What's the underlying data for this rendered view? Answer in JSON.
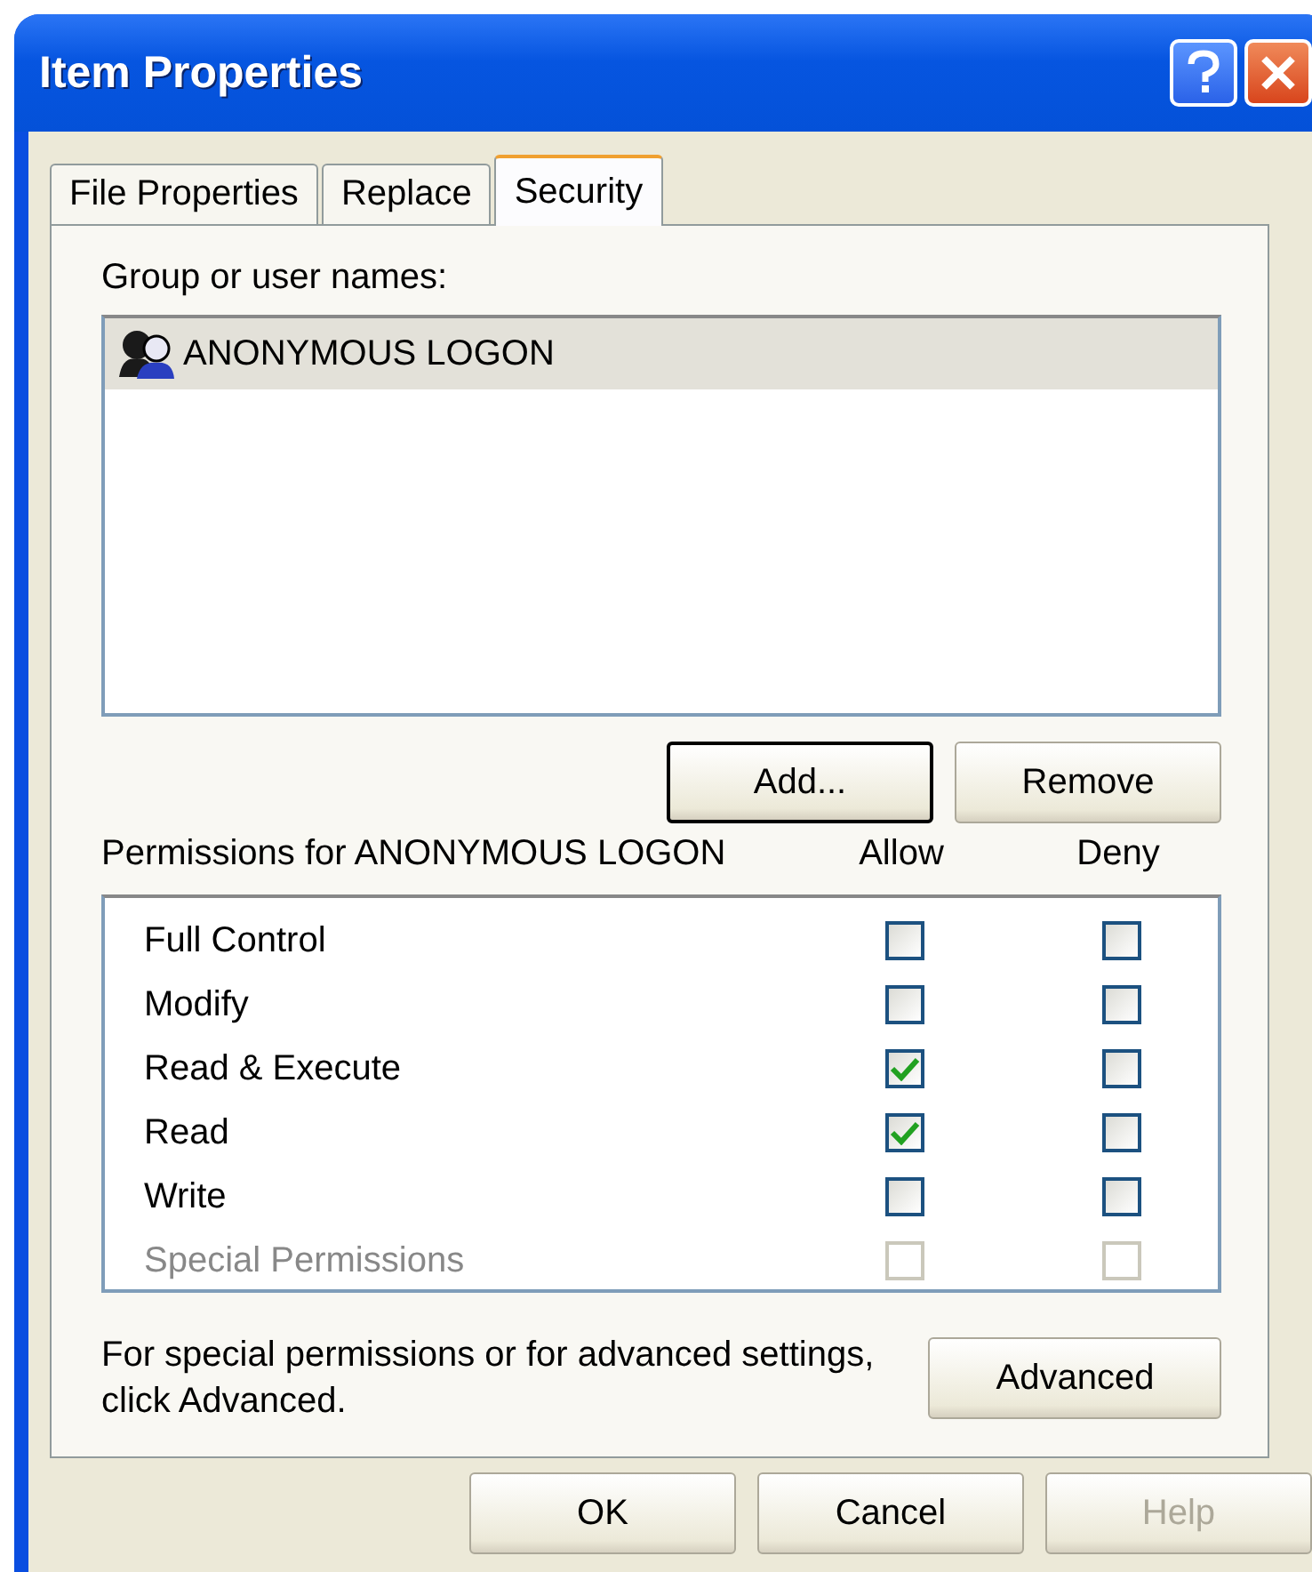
{
  "window": {
    "title": "Item Properties"
  },
  "tabs": [
    {
      "label": "File Properties",
      "selected": false
    },
    {
      "label": "Replace",
      "selected": false
    },
    {
      "label": "Security",
      "selected": true
    }
  ],
  "users": {
    "label": "Group or user names:",
    "items": [
      {
        "name": "ANONYMOUS LOGON",
        "selected": true
      }
    ]
  },
  "user_buttons": [
    {
      "label": "Add...",
      "focused": true,
      "disabled": false
    },
    {
      "label": "Remove",
      "focused": false,
      "disabled": false
    }
  ],
  "permissions": {
    "label": "Permissions for ANONYMOUS LOGON",
    "allow_header": "Allow",
    "deny_header": "Deny",
    "rows": [
      {
        "name": "Full Control",
        "disabled": false,
        "allow": false,
        "deny": false
      },
      {
        "name": "Modify",
        "disabled": false,
        "allow": false,
        "deny": false
      },
      {
        "name": "Read & Execute",
        "disabled": false,
        "allow": true,
        "deny": false
      },
      {
        "name": "Read",
        "disabled": false,
        "allow": true,
        "deny": false
      },
      {
        "name": "Write",
        "disabled": false,
        "allow": false,
        "deny": false
      },
      {
        "name": "Special Permissions",
        "disabled": true,
        "allow": false,
        "deny": false
      }
    ]
  },
  "advanced": {
    "text": "For special permissions or for advanced settings, click Advanced.",
    "button": "Advanced"
  },
  "dialog_buttons": [
    {
      "label": "OK",
      "disabled": false
    },
    {
      "label": "Cancel",
      "disabled": false
    },
    {
      "label": "Help",
      "disabled": true
    }
  ]
}
